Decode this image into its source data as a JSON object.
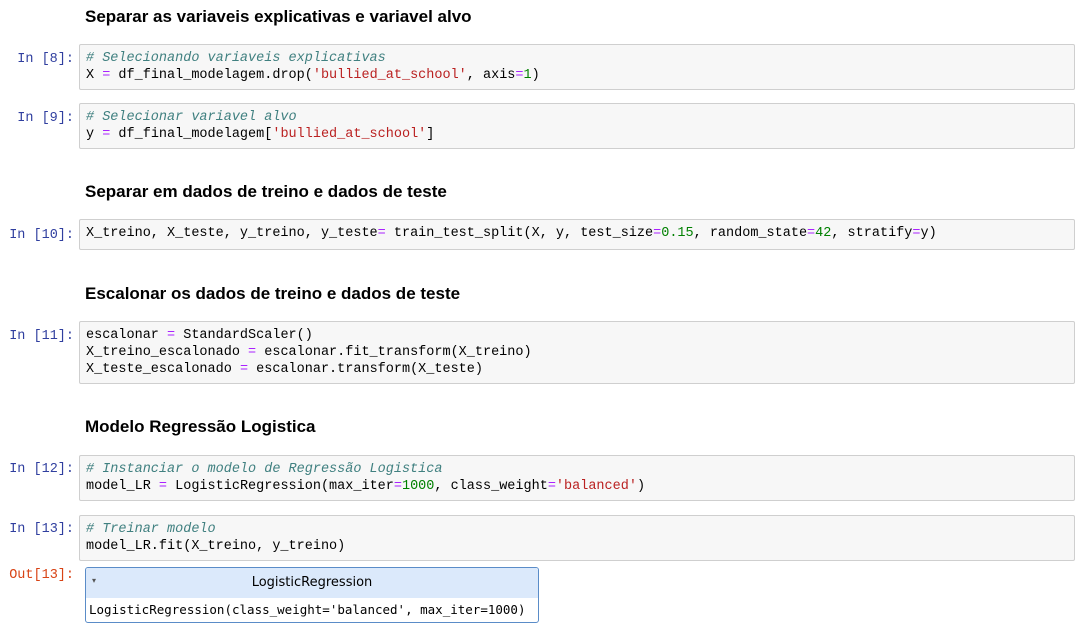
{
  "headings": {
    "h1": "Separar as variaveis explicativas e variavel alvo",
    "h2": "Separar em dados de treino e dados de teste",
    "h3": "Escalonar os dados de treino e dados de teste",
    "h4": "Modelo Regressão Logistica"
  },
  "cells": {
    "c8": {
      "prompt": "In [8]:",
      "l1": "# Selecionando variaveis explicativas",
      "l2a": "X ",
      "l2b": "=",
      "l2c": " df_final_modelagem.drop(",
      "l2d": "'bullied_at_school'",
      "l2e": ", axis",
      "l2f": "=",
      "l2g": "1",
      "l2h": ")"
    },
    "c9": {
      "prompt": "In [9]:",
      "l1": "# Selecionar variavel alvo",
      "l2a": "y ",
      "l2b": "=",
      "l2c": " df_final_modelagem[",
      "l2d": "'bullied_at_school'",
      "l2e": "]"
    },
    "c10": {
      "prompt": "In [10]:",
      "a": "X_treino, X_teste, y_treino, y_teste",
      "b": "=",
      "c": " train_test_split(X, y, test_size",
      "d": "=",
      "e": "0.15",
      "f": ", random_state",
      "g": "=",
      "h": "42",
      "i": ", stratify",
      "j": "=",
      "k": "y)"
    },
    "c11": {
      "prompt": "In [11]:",
      "l1a": "escalonar ",
      "l1b": "=",
      "l1c": " StandardScaler()",
      "l2a": "X_treino_escalonado ",
      "l2b": "=",
      "l2c": " escalonar.fit_transform(X_treino)",
      "l3a": "X_teste_escalonado ",
      "l3b": "=",
      "l3c": " escalonar.transform(X_teste)"
    },
    "c12": {
      "prompt": "In [12]:",
      "l1": "# Instanciar o modelo de Regressão Logistica",
      "l2a": "model_LR ",
      "l2b": "=",
      "l2c": " LogisticRegression(max_iter",
      "l2d": "=",
      "l2e": "1000",
      "l2f": ", class_weight",
      "l2g": "=",
      "l2h": "'balanced'",
      "l2i": ")"
    },
    "c13": {
      "prompt": "In [13]:",
      "l1": "# Treinar modelo",
      "l2": "model_LR.fit(X_treino, y_treino)"
    }
  },
  "output": {
    "prompt": "Out[13]:",
    "arrow": "▾",
    "title": "LogisticRegression",
    "body": "LogisticRegression(class_weight='balanced', max_iter=1000)"
  }
}
